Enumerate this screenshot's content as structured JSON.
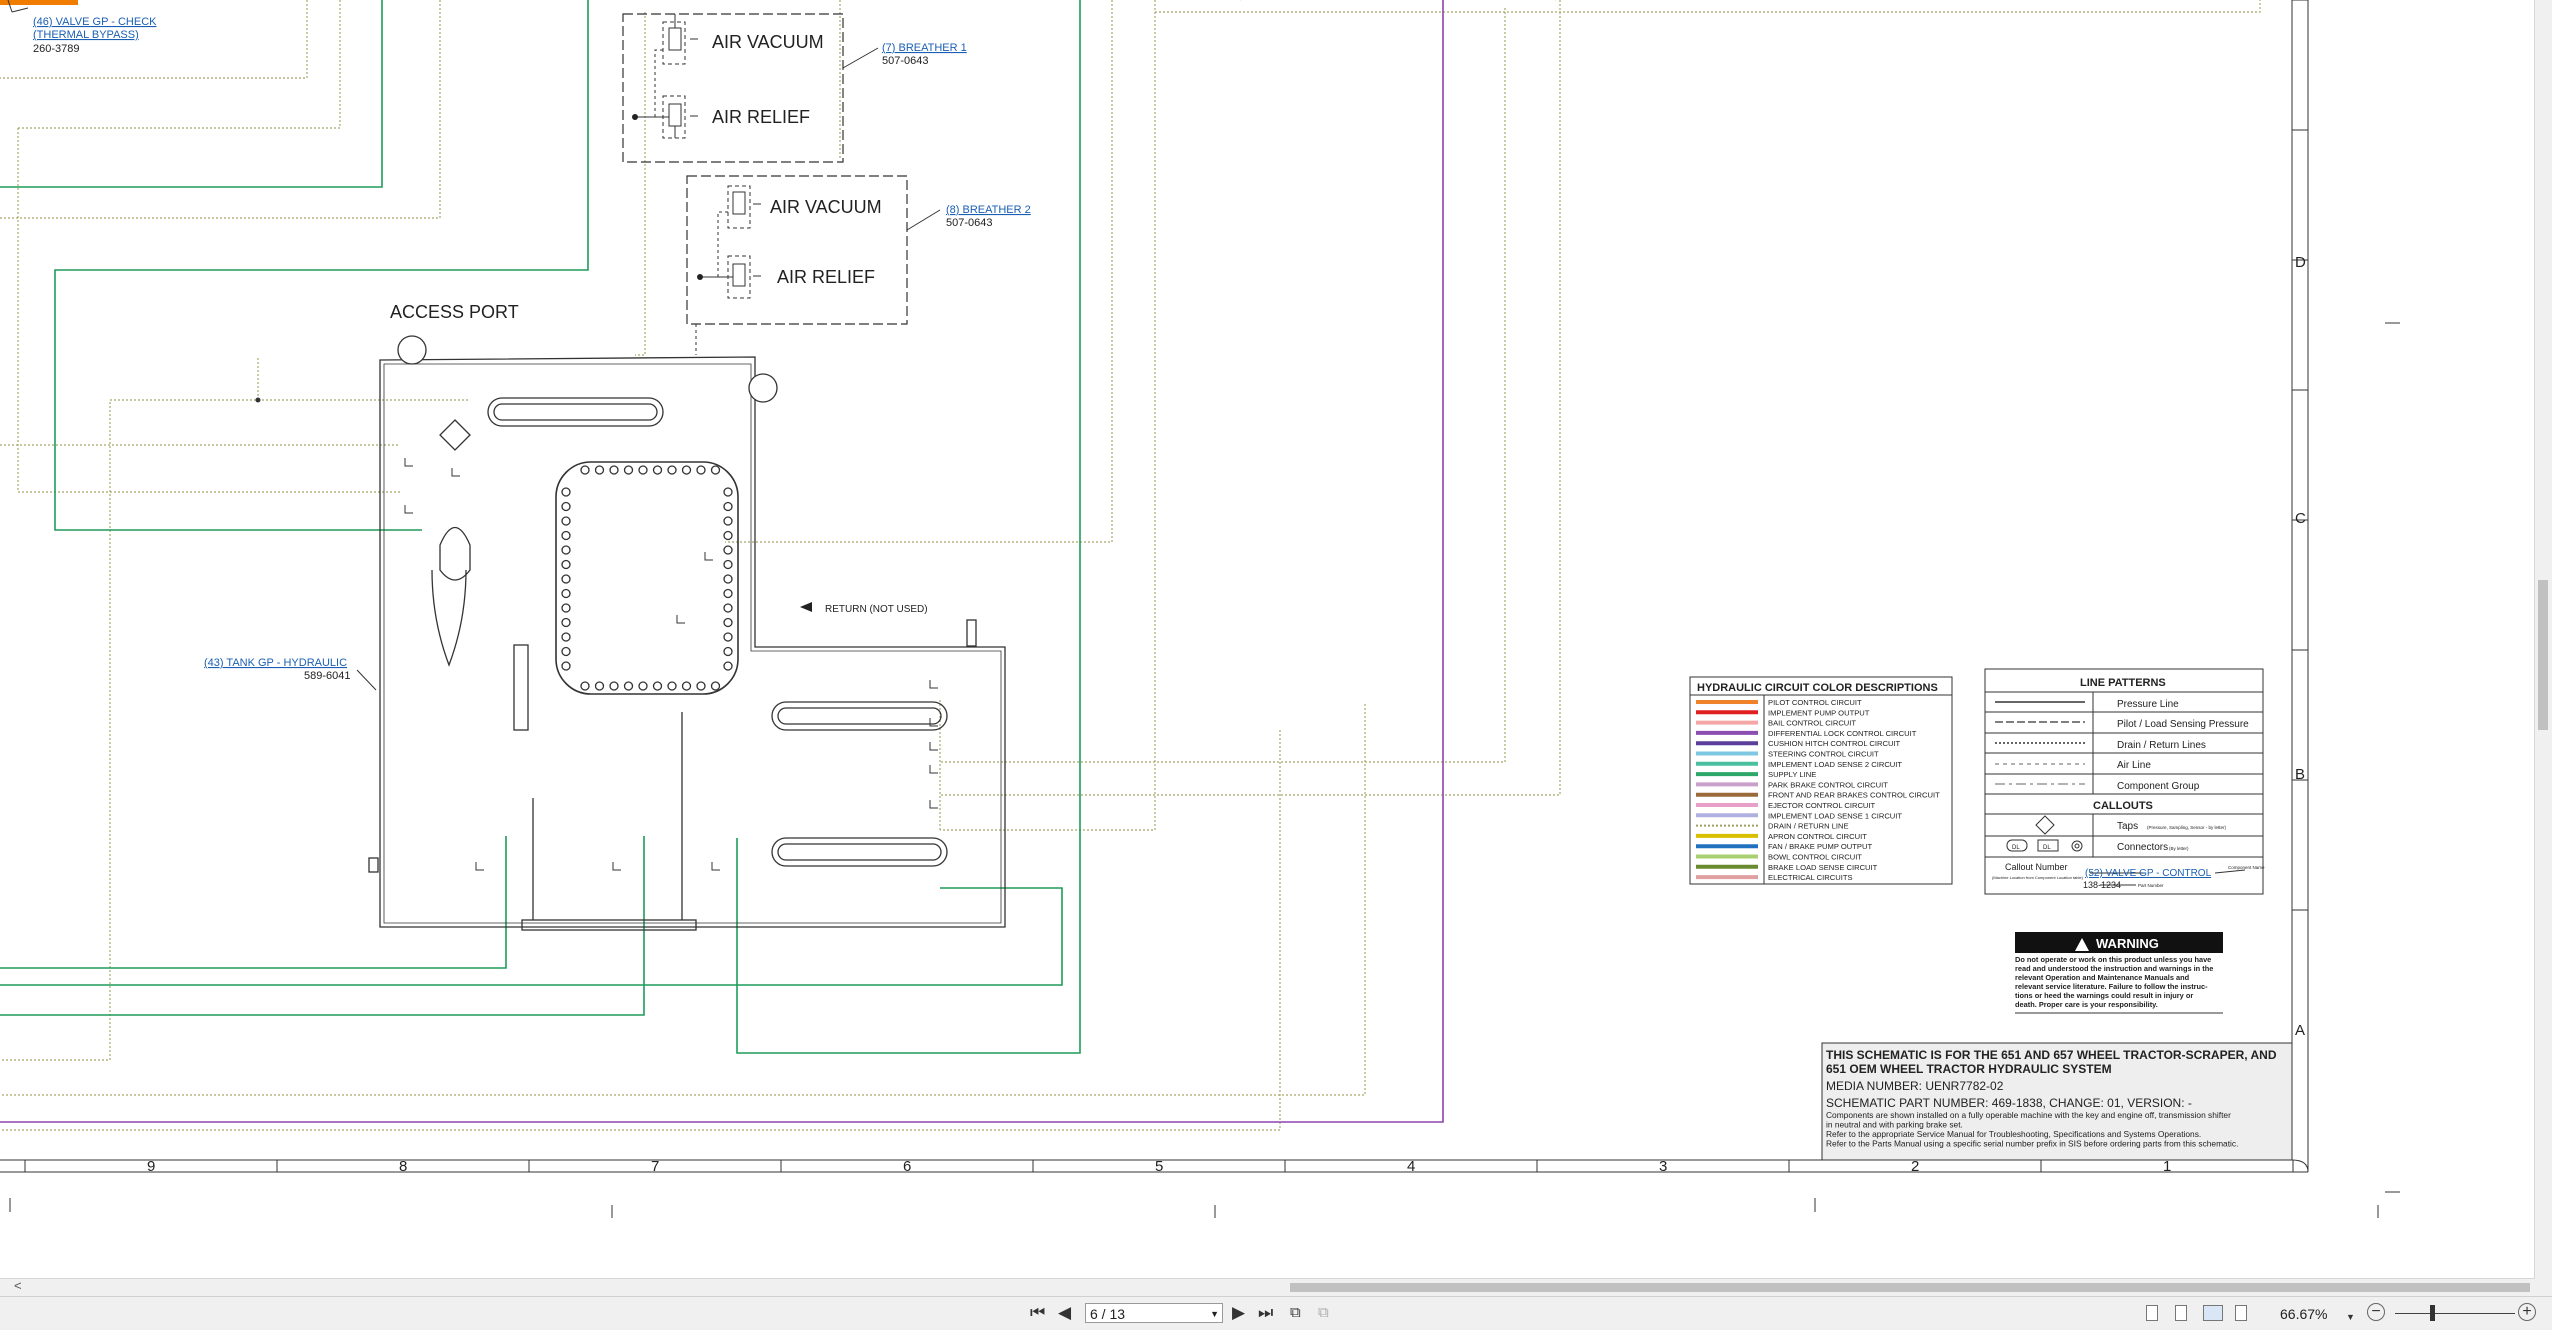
{
  "callouts": {
    "check_valve": {
      "link": "(46) VALVE GP - CHECK",
      "link2": "(THERMAL BYPASS)",
      "part": "260-3789"
    },
    "breather1": {
      "link": "(7) BREATHER 1",
      "part": "507-0643"
    },
    "breather2": {
      "link": "(8) BREATHER 2",
      "part": "507-0643"
    },
    "tank": {
      "link": "(43) TANK GP - HYDRAULIC",
      "part": "589-6041"
    }
  },
  "breather_labels": {
    "vacuum": "AIR VACUUM",
    "relief": "AIR RELIEF"
  },
  "access_port": "ACCESS PORT",
  "return_label": "RETURN (NOT USED)",
  "grid": {
    "columns": [
      "9",
      "8",
      "7",
      "6",
      "5",
      "4",
      "3",
      "2",
      "1"
    ],
    "rows": [
      "D",
      "C",
      "B",
      "A"
    ]
  },
  "color_legend": {
    "title": "HYDRAULIC CIRCUIT COLOR DESCRIPTIONS",
    "items": [
      {
        "label": "PILOT CONTROL CIRCUIT",
        "color": "#f0822a"
      },
      {
        "label": "IMPLEMENT PUMP OUTPUT",
        "color": "#e02020"
      },
      {
        "label": "BAIL CONTROL CIRCUIT",
        "color": "#f4a6a6"
      },
      {
        "label": "DIFFERENTIAL LOCK CONTROL CIRCUIT",
        "color": "#8a4fb0"
      },
      {
        "label": "CUSHION HITCH CONTROL CIRCUIT",
        "color": "#5a3e9a"
      },
      {
        "label": "STEERING CONTROL CIRCUIT",
        "color": "#7ec8e3"
      },
      {
        "label": "IMPLEMENT LOAD SENSE 2 CIRCUIT",
        "color": "#4ac0a0"
      },
      {
        "label": "SUPPLY LINE",
        "color": "#2ea86a"
      },
      {
        "label": "PARK BRAKE CONTROL CIRCUIT",
        "color": "#c9a0c9"
      },
      {
        "label": "FRONT AND REAR BRAKES CONTROL CIRCUIT",
        "color": "#9b6a3a"
      },
      {
        "label": "EJECTOR CONTROL CIRCUIT",
        "color": "#e8a0c8"
      },
      {
        "label": "IMPLEMENT LOAD SENSE 1 CIRCUIT",
        "color": "#b0b0e0"
      },
      {
        "label": "DRAIN / RETURN LINE",
        "color": "#a0a060"
      },
      {
        "label": "APRON CONTROL CIRCUIT",
        "color": "#d8c000"
      },
      {
        "label": "FAN / BRAKE PUMP OUTPUT",
        "color": "#2070c0"
      },
      {
        "label": "BOWL CONTROL CIRCUIT",
        "color": "#a8d070"
      },
      {
        "label": "BRAKE LOAD SENSE CIRCUIT",
        "color": "#6a8a30"
      },
      {
        "label": "ELECTRICAL CIRCUITS",
        "color": "#e0a0a0"
      }
    ]
  },
  "line_patterns": {
    "title": "LINE PATTERNS",
    "items": [
      "Pressure Line",
      "Pilot / Load Sensing Pressure",
      "Drain / Return Lines",
      "Air Line",
      "Component Group"
    ],
    "callouts_title": "CALLOUTS",
    "taps": "Taps",
    "taps_note": "(Pressure, Sampling, Sensor - by letter)",
    "connectors": "Connectors",
    "connectors_note": "(By letter)",
    "conn_letters": [
      "DL",
      "DL"
    ],
    "callout_number": "Callout Number",
    "callout_note": "(Machine Location from Component Location table)",
    "example_link": "(52) VALVE GP - CONTROL",
    "example_part": "138-1234",
    "component_name": "Component Name",
    "part_number": "Part Number"
  },
  "warning": {
    "title": "WARNING",
    "text": [
      "Do not operate or work on this product unless you have",
      "read and understood the instruction and warnings in the",
      "relevant Operation and Maintenance Manuals and",
      "relevant service literature. Failure to follow the instruc-",
      "tions or heed the warnings could result in injury or",
      "death. Proper care is your responsibility."
    ]
  },
  "title_block": {
    "heading1": "THIS SCHEMATIC IS FOR THE 651 AND 657 WHEEL TRACTOR-SCRAPER, AND",
    "heading2": "651 OEM WHEEL TRACTOR HYDRAULIC SYSTEM",
    "media": "MEDIA NUMBER: UENR7782-02",
    "part": "SCHEMATIC PART NUMBER: 469-1838, CHANGE: 01, VERSION: -",
    "notes": [
      "Components are shown installed on a fully operable machine with the key and engine off, transmission shifter",
      "in neutral and with parking brake set.",
      "Refer to the appropriate Service Manual for Troubleshooting, Specifications and Systems Operations.",
      "Refer to the Parts Manual using a specific serial number prefix in SIS before ordering parts from this schematic."
    ]
  },
  "viewer": {
    "page": "6 / 13",
    "zoom": "66.67%"
  },
  "colors": {
    "supply": "#1e9c5a",
    "drain": "#a8a868",
    "electrical": "#8e44ad",
    "link": "#1a5fb4"
  }
}
